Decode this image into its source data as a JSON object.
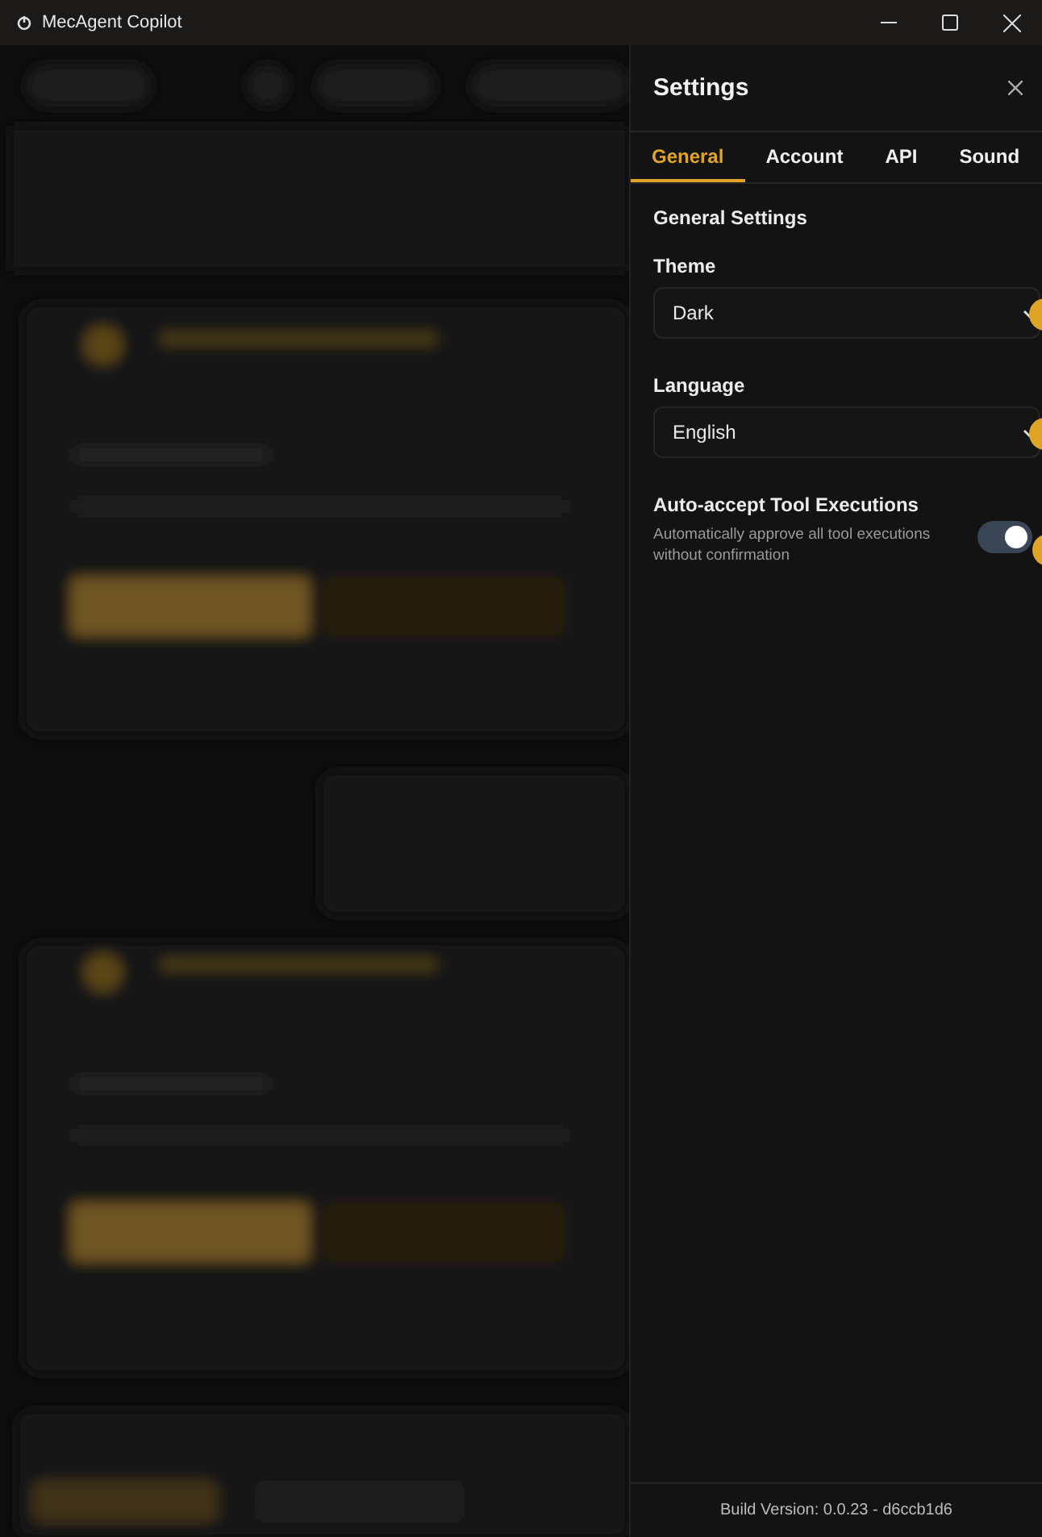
{
  "window": {
    "title": "MecAgent Copilot"
  },
  "settings": {
    "title": "Settings",
    "tabs": [
      {
        "label": "General",
        "selected": true
      },
      {
        "label": "Account",
        "selected": false
      },
      {
        "label": "API",
        "selected": false
      },
      {
        "label": "Sound",
        "selected": false
      }
    ],
    "section_title": "General Settings",
    "fields": [
      {
        "kind": "select",
        "label": "Theme",
        "value": "Dark"
      },
      {
        "kind": "select",
        "label": "Language",
        "value": "English"
      },
      {
        "kind": "toggle",
        "label": "Auto-accept Tool Executions",
        "description": "Automatically approve all tool executions without confirmation",
        "on": true
      }
    ],
    "build_version": "Build Version: 0.0.23 - d6ccb1d6"
  }
}
